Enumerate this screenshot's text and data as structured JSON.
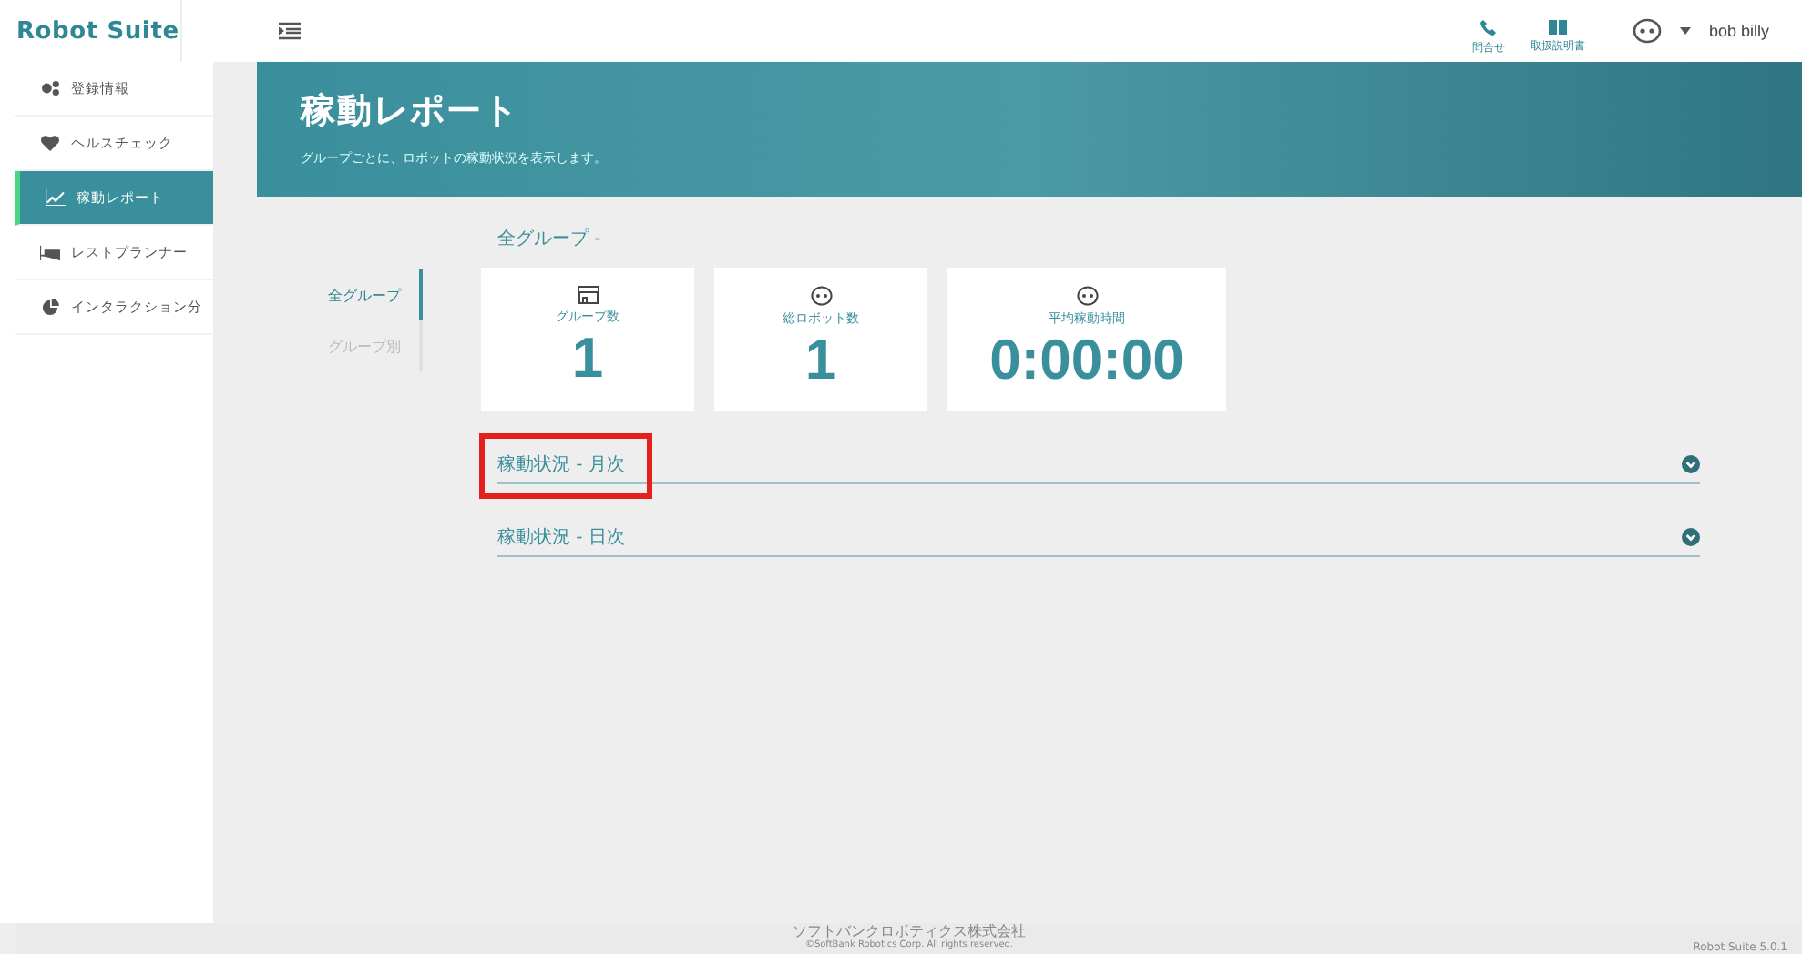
{
  "app": {
    "logo": "Robot Suite"
  },
  "topbar": {
    "actions": [
      {
        "label": "問合せ",
        "kind": "phone"
      },
      {
        "label": "取扱説明書",
        "kind": "book"
      }
    ],
    "user": "bob billy"
  },
  "sidebar": {
    "items": [
      {
        "label": "登録情報",
        "kind": "gears",
        "selected": false
      },
      {
        "label": "ヘルスチェック",
        "kind": "heart",
        "selected": false
      },
      {
        "label": "稼動レポート",
        "kind": "chart",
        "selected": true
      },
      {
        "label": "レストプランナー",
        "kind": "bed",
        "selected": false
      },
      {
        "label": "インタラクション分",
        "kind": "pie",
        "selected": false
      }
    ]
  },
  "banner": {
    "title": "稼動レポート",
    "subtitle": "グループごとに、ロボットの稼動状況を表示します。"
  },
  "tabs": [
    {
      "label": "全グループ",
      "selected": true
    },
    {
      "label": "グループ別",
      "selected": false
    }
  ],
  "section_title": "全グループ -",
  "stats": [
    {
      "label": "グループ数",
      "value": "1",
      "kind": "store"
    },
    {
      "label": "総ロボット数",
      "value": "1",
      "kind": "robot"
    },
    {
      "label": "平均稼動時間",
      "value": "0:00:00",
      "kind": "robot"
    }
  ],
  "accordions": [
    {
      "title": "稼動状況 - 月次",
      "highlighted": true
    },
    {
      "title": "稼動状況 - 日次",
      "highlighted": false
    }
  ],
  "footer": {
    "company": "ソフトバンクロボティクス株式会社",
    "copyright": "©SoftBank Robotics Corp. All rights reserved.",
    "version": "Robot Suite 5.0.1"
  }
}
